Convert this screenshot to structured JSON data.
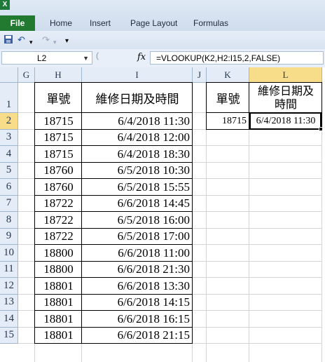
{
  "ribbon": {
    "app_logo": "X",
    "tabs": [
      "File",
      "Home",
      "Insert",
      "Page Layout",
      "Formulas"
    ]
  },
  "quick_access": {
    "icons": [
      "save-icon",
      "undo-icon",
      "redo-icon",
      "customize-icon"
    ]
  },
  "formula_bar": {
    "name_box": "L2",
    "fx_label": "fx",
    "formula": "=VLOOKUP(K2,H2:I15,2,FALSE)"
  },
  "grid": {
    "columns": [
      "G",
      "H",
      "I",
      "J",
      "K",
      "L"
    ],
    "selected_column": "L",
    "rows": [
      "1",
      "2",
      "3",
      "4",
      "5",
      "6",
      "7",
      "8",
      "9",
      "10",
      "11",
      "12",
      "13",
      "14",
      "15"
    ],
    "selected_row": "2",
    "table_headers": [
      "單號",
      "維修日期及時間"
    ],
    "table_rows": [
      [
        "18715",
        "6/4/2018 11:30"
      ],
      [
        "18715",
        "6/4/2018 12:00"
      ],
      [
        "18715",
        "6/4/2018 18:30"
      ],
      [
        "18760",
        "6/5/2018 10:30"
      ],
      [
        "18760",
        "6/5/2018 15:55"
      ],
      [
        "18722",
        "6/6/2018 14:45"
      ],
      [
        "18722",
        "6/5/2018 16:00"
      ],
      [
        "18722",
        "6/5/2018 17:00"
      ],
      [
        "18800",
        "6/6/2018 11:00"
      ],
      [
        "18800",
        "6/6/2018 21:30"
      ],
      [
        "18801",
        "6/6/2018 13:30"
      ],
      [
        "18801",
        "6/6/2018 14:15"
      ],
      [
        "18801",
        "6/6/2018 16:15"
      ],
      [
        "18801",
        "6/6/2018 21:15"
      ]
    ],
    "lookup_headers": [
      "單號",
      "維修日期及時間"
    ],
    "lookup_row": [
      "18715",
      "6/4/2018 11:30"
    ]
  }
}
